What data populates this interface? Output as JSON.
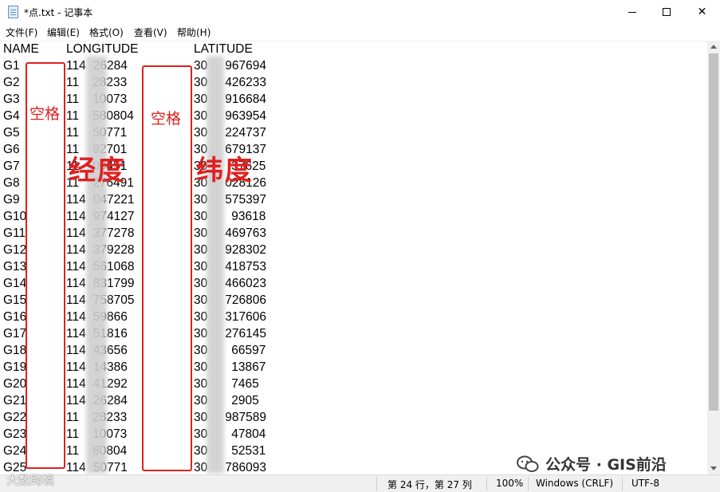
{
  "window": {
    "title": "*点.txt - 记事本",
    "minimize_glyph": "—",
    "close_glyph": "✕"
  },
  "menu": [
    "文件(F)",
    "编辑(E)",
    "格式(O)",
    "查看(V)",
    "帮助(H)"
  ],
  "header": {
    "name": "NAME",
    "longitude": "LONGITUDE",
    "latitude": "LATITUDE"
  },
  "rows": [
    {
      "name": "G1",
      "lon": "114",
      "lon_tail": "26284",
      "lat": "30",
      "lat_tail": "967694"
    },
    {
      "name": "G2",
      "lon": "11",
      "lon_tail": "28233",
      "lat": "30",
      "lat_tail": "426233"
    },
    {
      "name": "G3",
      "lon": "11",
      "lon_tail": "10073",
      "lat": "30",
      "lat_tail": "916684"
    },
    {
      "name": "G4",
      "lon": "11",
      "lon_tail": "580804",
      "lat": "30",
      "lat_tail": "963954"
    },
    {
      "name": "G5",
      "lon": "11",
      "lon_tail": "50771",
      "lat": "30",
      "lat_tail": "224737"
    },
    {
      "name": "G6",
      "lon": "11",
      "lon_tail": "92701",
      "lat": "30",
      "lat_tail": "679137"
    },
    {
      "name": "G7",
      "lon": "11",
      "lon_tail": "09451",
      "lat": "30",
      "lat_tail": "37625"
    },
    {
      "name": "G8",
      "lon": "11",
      "lon_tail": "276491",
      "lat": "30",
      "lat_tail": "028126"
    },
    {
      "name": "G9",
      "lon": "114",
      "lon_tail": "047221",
      "lat": "30",
      "lat_tail": "575397"
    },
    {
      "name": "G10",
      "lon": "114",
      "lon_tail": "974127",
      "lat": "30",
      "lat_tail": "93618"
    },
    {
      "name": "G11",
      "lon": "114",
      "lon_tail": "377278",
      "lat": "30",
      "lat_tail": "469763"
    },
    {
      "name": "G12",
      "lon": "114",
      "lon_tail": "379228",
      "lat": "30",
      "lat_tail": "928302"
    },
    {
      "name": "G13",
      "lon": "114",
      "lon_tail": "561068",
      "lat": "30",
      "lat_tail": "418753"
    },
    {
      "name": "G14",
      "lon": "114",
      "lon_tail": "831799",
      "lat": "30",
      "lat_tail": "466023"
    },
    {
      "name": "G15",
      "lon": "114",
      "lon_tail": "758705",
      "lat": "30",
      "lat_tail": "726806"
    },
    {
      "name": "G16",
      "lon": "114",
      "lon_tail": "59866",
      "lat": "30",
      "lat_tail": "317606"
    },
    {
      "name": "G17",
      "lon": "114",
      "lon_tail": "51816",
      "lat": "30",
      "lat_tail": "276145"
    },
    {
      "name": "G18",
      "lon": "114",
      "lon_tail": "43656",
      "lat": "30",
      "lat_tail": "66597"
    },
    {
      "name": "G19",
      "lon": "114",
      "lon_tail": "14386",
      "lat": "30",
      "lat_tail": "13867"
    },
    {
      "name": "G20",
      "lon": "114",
      "lon_tail": "41292",
      "lat": "30",
      "lat_tail": "7465"
    },
    {
      "name": "G21",
      "lon": "114",
      "lon_tail": "26284",
      "lat": "30",
      "lat_tail": "2905"
    },
    {
      "name": "G22",
      "lon": "11",
      "lon_tail": "28233",
      "lat": "30",
      "lat_tail": "987589"
    },
    {
      "name": "G23",
      "lon": "11",
      "lon_tail": "10073",
      "lat": "30",
      "lat_tail": "47804"
    },
    {
      "name": "G24",
      "lon": "11",
      "lon_tail": "80804",
      "lat": "30",
      "lat_tail": "52531"
    },
    {
      "name": "G25",
      "lon": "114",
      "lon_tail": "50771",
      "lat": "30",
      "lat_tail": "786093"
    }
  ],
  "annotations": {
    "space_label_1": "空格",
    "space_label_2": "空格",
    "longitude_label": "经度",
    "latitude_label": "纬度",
    "color": "#e02020"
  },
  "status": {
    "position": "第 24 行，第 27 列",
    "zoom": "100%",
    "line_ending": "Windows (CRLF)",
    "encoding": "UTF-8"
  },
  "watermarks": {
    "wechat": "公众号 · GIS前沿",
    "corner": "大数跨境"
  },
  "icons": [
    "notepad-icon",
    "minimize-icon",
    "maximize-icon",
    "close-icon",
    "scroll-up-icon",
    "scroll-down-icon",
    "wechat-icon"
  ]
}
